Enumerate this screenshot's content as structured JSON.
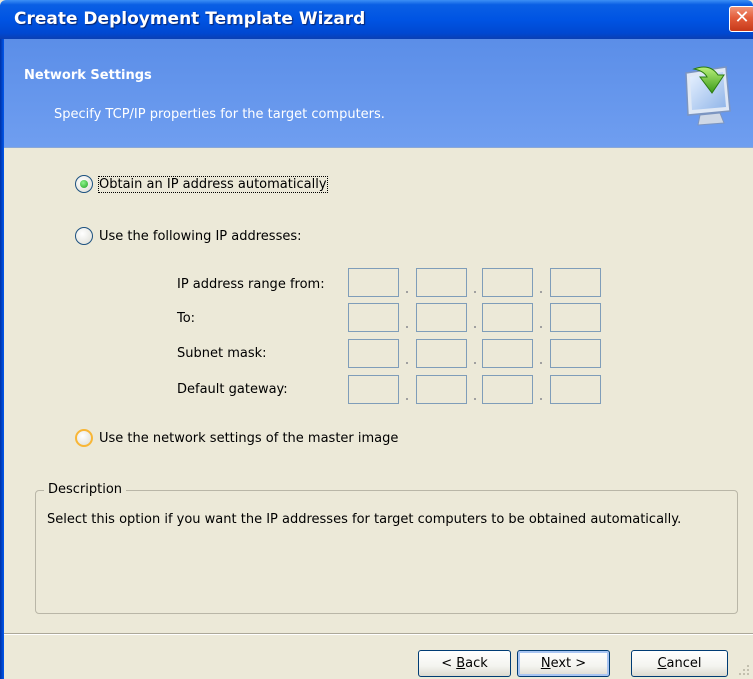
{
  "window": {
    "title": "Create Deployment Template Wizard",
    "close_glyph": "✕"
  },
  "header": {
    "title": "Network Settings",
    "subtitle": "Specify TCP/IP properties for the target computers.",
    "icon": "monitor-download-icon"
  },
  "options": {
    "auto": {
      "label": "Obtain an IP address automatically",
      "selected": true
    },
    "manual": {
      "label": "Use the following IP addresses:",
      "selected": false
    },
    "master": {
      "label": "Use the network settings of the master image",
      "selected": false
    }
  },
  "ip_fields": {
    "range_from": {
      "label": "IP address range from:",
      "octets": [
        "",
        "",
        "",
        ""
      ]
    },
    "to": {
      "label": "To:",
      "octets": [
        "",
        "",
        "",
        ""
      ]
    },
    "subnet": {
      "label": "Subnet mask:",
      "octets": [
        "",
        "",
        "",
        ""
      ]
    },
    "gateway": {
      "label": "Default gateway:",
      "octets": [
        "",
        "",
        "",
        ""
      ]
    }
  },
  "description": {
    "legend": "Description",
    "text": "Select this option if you want the IP addresses for target computers to be obtained automatically."
  },
  "buttons": {
    "back": {
      "before": "< ",
      "mnemonic": "B",
      "after": "ack"
    },
    "next": {
      "before": "",
      "mnemonic": "N",
      "after": "ext >"
    },
    "cancel": {
      "before": "",
      "mnemonic": "C",
      "after": "ancel"
    }
  },
  "colors": {
    "titlebar": "#0054e3",
    "header": "#6f9ef0",
    "window_bg": "#ece9d8",
    "close": "#e35d3a"
  }
}
